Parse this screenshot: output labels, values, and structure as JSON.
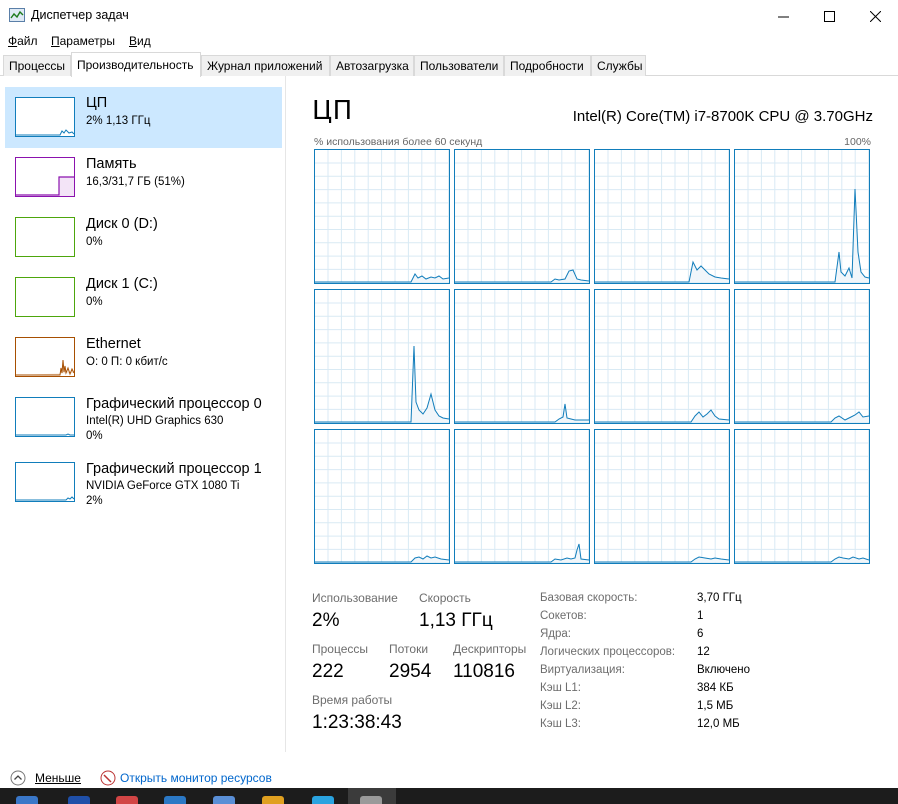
{
  "window": {
    "title": "Диспетчер задач"
  },
  "menu": [
    {
      "label": "Файл",
      "u": "Ф",
      "rest": "айл"
    },
    {
      "label": "Параметры",
      "u": "П",
      "rest": "араметры"
    },
    {
      "label": "Вид",
      "u": "В",
      "rest": "ид"
    }
  ],
  "tabs": [
    "Процессы",
    "Производительность",
    "Журнал приложений",
    "Автозагрузка",
    "Пользователи",
    "Подробности",
    "Службы"
  ],
  "active_tab": "Производительность",
  "sidebar": {
    "items": [
      {
        "name": "ЦП",
        "sub1": "2% 1,13 ГГц",
        "sub2": "",
        "color": "#117dbb",
        "selected": true
      },
      {
        "name": "Память",
        "sub1": "16,3/31,7 ГБ (51%)",
        "sub2": "",
        "color": "#8b12ae",
        "selected": false
      },
      {
        "name": "Диск 0 (D:)",
        "sub1": "0%",
        "sub2": "",
        "color": "#4da60c",
        "selected": false
      },
      {
        "name": "Диск 1 (C:)",
        "sub1": "0%",
        "sub2": "",
        "color": "#4da60c",
        "selected": false
      },
      {
        "name": "Ethernet",
        "sub1": "О: 0 П: 0 кбит/с",
        "sub2": "",
        "color": "#a74f01",
        "selected": false
      },
      {
        "name": "Графический процессор 0",
        "sub1": "Intel(R) UHD Graphics 630",
        "sub2": "0%",
        "color": "#117dbb",
        "selected": false
      },
      {
        "name": "Графический процессор 1",
        "sub1": "NVIDIA GeForce GTX 1080 Ti",
        "sub2": "2%",
        "color": "#117dbb",
        "selected": false
      }
    ]
  },
  "main": {
    "title": "ЦП",
    "cpu_model": "Intel(R) Core(TM) i7-8700K CPU @ 3.70GHz",
    "axis_left": "% использования более 60 секунд",
    "axis_right": "100%",
    "graph_color": "#117dbb",
    "grid_color": "#d9eaf4"
  },
  "stats": {
    "usage_label": "Использование",
    "usage_value": "2%",
    "speed_label": "Скорость",
    "speed_value": "1,13 ГГц",
    "processes_label": "Процессы",
    "processes_value": "222",
    "threads_label": "Потоки",
    "threads_value": "2954",
    "handles_label": "Дескрипторы",
    "handles_value": "110816",
    "uptime_label": "Время работы",
    "uptime_value": "1:23:38:43"
  },
  "details": [
    {
      "k": "Базовая скорость:",
      "v": "3,70 ГГц"
    },
    {
      "k": "Сокетов:",
      "v": "1"
    },
    {
      "k": "Ядра:",
      "v": "6"
    },
    {
      "k": "Логических процессоров:",
      "v": "12"
    },
    {
      "k": "Виртуализация:",
      "v": "Включено"
    },
    {
      "k": "Кэш L1:",
      "v": "384 КБ"
    },
    {
      "k": "Кэш L2:",
      "v": "1,5 МБ"
    },
    {
      "k": "Кэш L3:",
      "v": "12,0 МБ"
    }
  ],
  "footer": {
    "less": "Меньше",
    "monitor": "Открыть монитор ресурсов"
  },
  "taskbar": {
    "icons": [
      "start-icon",
      "folder-icon",
      "browser-icon",
      "app-icon-1",
      "app-icon-2",
      "app-icon-3",
      "telegram-icon",
      "taskmgr-icon"
    ]
  }
}
